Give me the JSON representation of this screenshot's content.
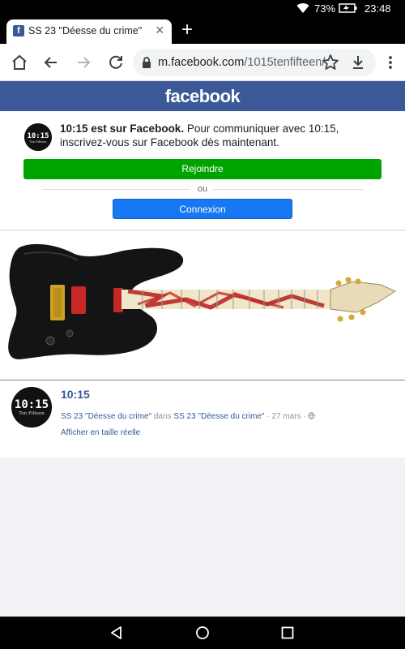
{
  "status": {
    "battery": "73%",
    "time": "23:48"
  },
  "tab": {
    "title": "SS 23 \"Déesse du crime\"",
    "favicon_letter": "f"
  },
  "url": {
    "host": "m.facebook.com",
    "path": "/1015tenfifteen/"
  },
  "header": {
    "brand": "facebook"
  },
  "promo": {
    "page_name": "10:15 est sur Facebook.",
    "message": " Pour communiquer avec 10:15, inscrivez-vous sur Facebook dès maintenant.",
    "join_label": "Rejoindre",
    "or_label": "ou",
    "login_label": "Connexion"
  },
  "logo": {
    "big_text": "10:15",
    "small_text": "Ten Fifteen"
  },
  "post": {
    "title": "10:15",
    "album_1": "SS 23 \"Déesse du crime\"",
    "in_label": " dans ",
    "album_2": "SS 23 \"Déesse du crime\"",
    "date": " · 27 mars · ",
    "full_size_label": "Afficher en taille réelle"
  },
  "colors": {
    "facebook_blue": "#3b5998",
    "join_green": "#00a400",
    "login_blue": "#1877f2",
    "link": "#365899"
  },
  "icons": [
    "wifi-icon",
    "battery-icon",
    "home-icon",
    "back-icon",
    "forward-icon",
    "reload-icon",
    "lock-icon",
    "star-icon",
    "download-icon",
    "menu-icon",
    "globe-icon",
    "nav-back-icon",
    "nav-home-icon",
    "nav-recents-icon"
  ]
}
